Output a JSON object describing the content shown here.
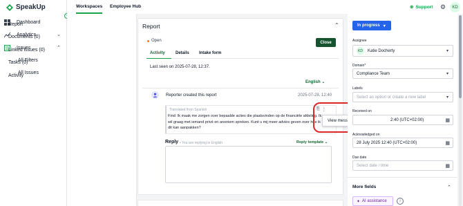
{
  "app": {
    "name": "SpeakUp"
  },
  "sidebar": {
    "items": [
      {
        "label": "Dashboard"
      },
      {
        "label": "Analytics"
      },
      {
        "label": "Issues"
      }
    ],
    "sub_items": [
      {
        "label": "All Filters"
      },
      {
        "label": "All Issues"
      }
    ]
  },
  "topbar": {
    "tabs": [
      {
        "label": "Workspaces"
      },
      {
        "label": "Employee Hub"
      }
    ],
    "support_label": "Support",
    "avatar_initials": "KD"
  },
  "report_nav": {
    "items": [
      {
        "label": "Report"
      },
      {
        "label": "Documents (0)"
      },
      {
        "label": "Linked issues (0)"
      },
      {
        "label": "Tasks (0)"
      },
      {
        "label": "Activity"
      }
    ]
  },
  "report": {
    "title": "Report",
    "status": "Open",
    "close_label": "Close",
    "tabs": [
      {
        "label": "Activity"
      },
      {
        "label": "Details"
      },
      {
        "label": "Intake form"
      }
    ],
    "last_seen": "Last seen on 2025-07-28, 12:37.",
    "language": "English",
    "reporter_text": "Reporter created this report",
    "reporter_date": "2025-07-28, 12:40",
    "translated_label": "Translated from Spanish",
    "message": "Find: Ik maak me zorgen over bepaalde acties die plaatsvinden op de financiële afdeling. Ik wil graag met iemand privé en anoniem spreken. Kunt u mij meer advies geven over hoe ik dit kan aanpakken?",
    "tooltip": "View messages side by side",
    "reply_label": "Reply",
    "reply_hint": "You are replying in English",
    "reply_template": "Reply template"
  },
  "right_panel": {
    "status_button": "In progress",
    "assignee_label": "Assignee",
    "assignee_initials": "KD",
    "assignee_name": "Katie Docherty",
    "domain_label": "Domain*",
    "domain_value": "Compliance Team",
    "labels_label": "Labels",
    "labels_placeholder": "Select an option or create a new label",
    "received_label": "Received on",
    "received_value": "2:40 (UTC+02:00)",
    "acknowledged_label": "Acknowledged on",
    "acknowledged_value": "28 July 2025 12:40 (UTC+02:00)",
    "due_label": "Due date",
    "due_placeholder": "Select date / time",
    "more_fields": "More fields",
    "ai_button": "AI assistance"
  },
  "colors": {
    "brand_green": "#16a34a",
    "dark_green": "#14532d",
    "status_blue": "#2563eb",
    "highlight_red": "#dc2626"
  }
}
